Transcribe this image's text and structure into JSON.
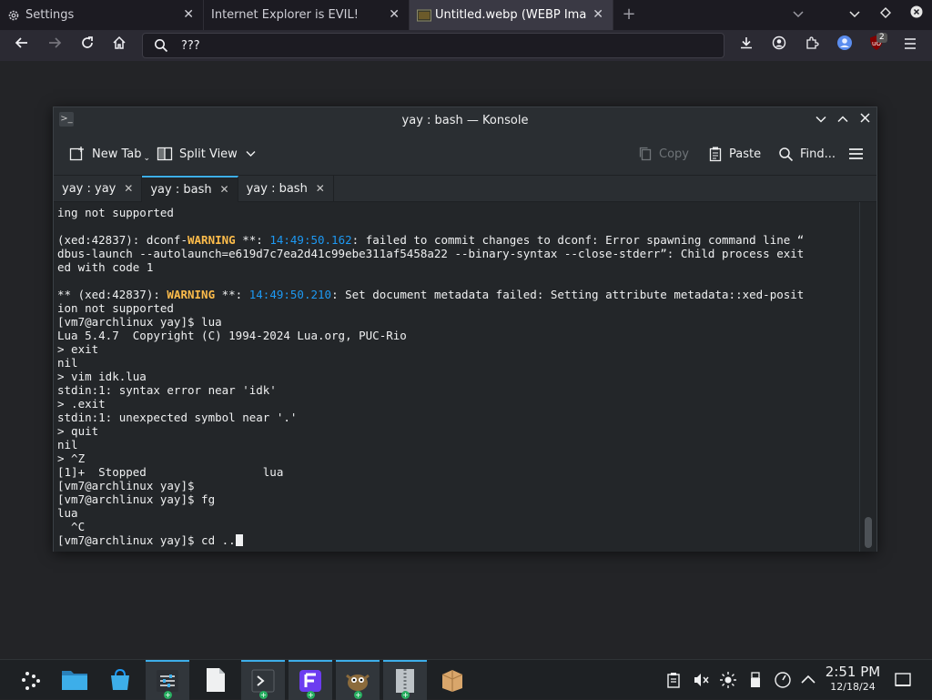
{
  "browser": {
    "tabs": [
      {
        "label": "Settings",
        "active": false
      },
      {
        "label": "Internet Explorer is EVIL!",
        "active": false
      },
      {
        "label": "Untitled.webp (WEBP Imag",
        "active": true
      }
    ],
    "new_tab_symbol": "+",
    "url": "???",
    "extension_badge": "2"
  },
  "konsole": {
    "title": "yay : bash — Konsole",
    "toolbar": {
      "new_tab": "New Tab",
      "split_view": "Split View",
      "copy": "Copy",
      "paste": "Paste",
      "find": "Find..."
    },
    "tabs": [
      {
        "label": "yay : yay",
        "active": false
      },
      {
        "label": "yay : bash",
        "active": true
      },
      {
        "label": "yay : bash",
        "active": false
      }
    ],
    "terminal": {
      "l1": "ing not supported",
      "l2": "",
      "l3a": "(xed:42837): dconf-",
      "l3warn": "WARNING",
      "l3b": " **: ",
      "l3ts": "14:49:50.162",
      "l3c": ": failed to commit changes to dconf: Error spawning command line “",
      "l4": "dbus-launch --autolaunch=e619d7c7ea2d41c99ebe311af5458a22 --binary-syntax --close-stderr”: Child process exit",
      "l5": "ed with code 1",
      "l6": "",
      "l7a": "** (xed:42837): ",
      "l7warn": "WARNING",
      "l7b": " **: ",
      "l7ts": "14:49:50.210",
      "l7c": ": Set document metadata failed: Setting attribute metadata::xed-posit",
      "l8": "ion not supported",
      "l9": "[vm7@archlinux yay]$ lua",
      "l10": "Lua 5.4.7  Copyright (C) 1994-2024 Lua.org, PUC-Rio",
      "l11": "> exit",
      "l12": "nil",
      "l13": "> vim idk.lua",
      "l14": "stdin:1: syntax error near 'idk'",
      "l15": "> .exit",
      "l16": "stdin:1: unexpected symbol near '.'",
      "l17": "> quit",
      "l18": "nil",
      "l19": "> ^Z",
      "l20": "[1]+  Stopped                 lua",
      "l21": "[vm7@archlinux yay]$",
      "l22": "[vm7@archlinux yay]$ fg",
      "l23": "lua",
      "l24": "  ^C",
      "l25": "[vm7@archlinux yay]$ cd .."
    }
  },
  "taskbar": {
    "time": "2:51 PM",
    "date": "12/18/24"
  },
  "colors": {
    "accent": "#3daee9",
    "warning": "#fdbc4b",
    "timestamp": "#1d99f3"
  }
}
